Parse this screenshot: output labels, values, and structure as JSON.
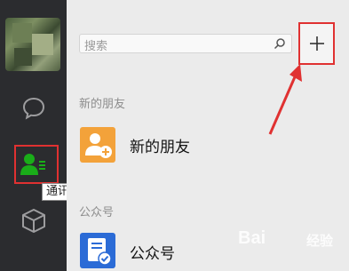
{
  "sidebar": {
    "icons": [
      "chat-icon",
      "contacts-icon",
      "box-icon"
    ],
    "tooltip": "通讯录",
    "accent_color": "#1aad19",
    "highlight_color": "#e03131"
  },
  "search": {
    "placeholder": "搜索"
  },
  "toolbar": {
    "add_label": "+"
  },
  "sections": {
    "new_friends": "新的朋友",
    "public_accounts": "公众号"
  },
  "rows": [
    {
      "label": "新的朋友",
      "icon": "add-friend-icon",
      "color": "#f3a23a"
    },
    {
      "label": "公众号",
      "icon": "official-account-icon",
      "color": "#2b6bd6"
    }
  ],
  "watermark": {
    "brand": "Bai",
    "suffix": "经验"
  }
}
